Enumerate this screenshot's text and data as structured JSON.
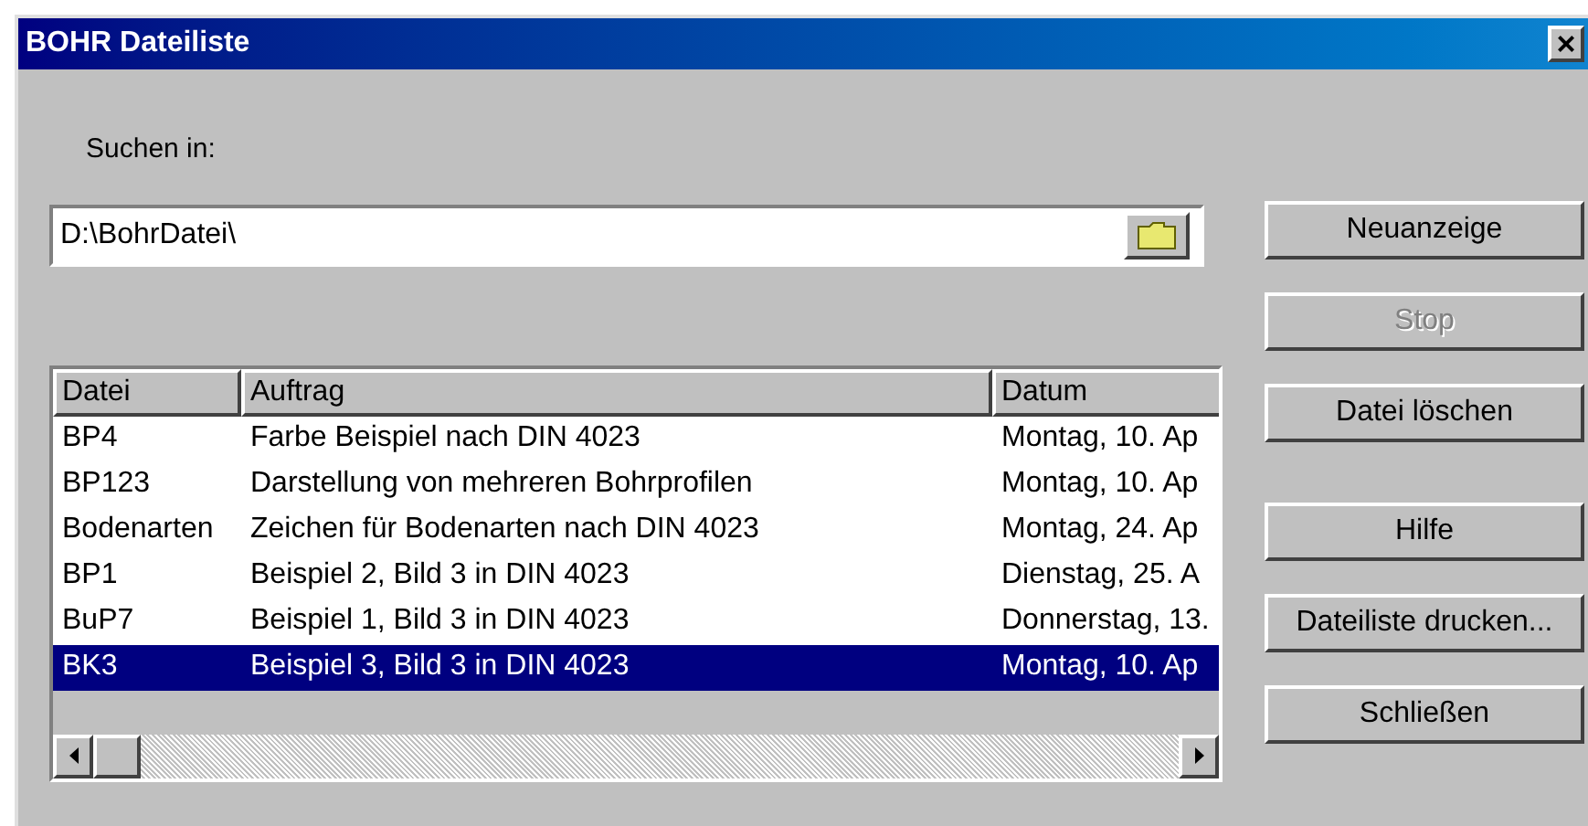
{
  "window": {
    "title": "BOHR Dateiliste",
    "close": "×"
  },
  "search_in": {
    "label": "Suchen in:",
    "value": "D:\\BohrDatei\\"
  },
  "table": {
    "columns": [
      "Datei",
      "Auftrag",
      "Datum"
    ],
    "rows": [
      {
        "cells": [
          "BP4",
          "Farbe Beispiel nach DIN 4023",
          "Montag, 10. Ap"
        ],
        "selected": false
      },
      {
        "cells": [
          "BP123",
          "Darstellung von mehreren Bohrprofilen",
          "Montag, 10. Ap"
        ],
        "selected": false
      },
      {
        "cells": [
          "Bodenarten",
          "Zeichen für Bodenarten nach DIN 4023",
          "Montag, 24. Ap"
        ],
        "selected": false
      },
      {
        "cells": [
          "BP1",
          "Beispiel 2, Bild 3 in DIN 4023",
          "Dienstag, 25. A"
        ],
        "selected": false
      },
      {
        "cells": [
          "BuP7",
          "Beispiel 1, Bild 3 in DIN 4023",
          "Donnerstag, 13."
        ],
        "selected": false
      },
      {
        "cells": [
          "BK3",
          "Beispiel 3, Bild 3 in DIN 4023",
          "Montag, 10. Ap"
        ],
        "selected": true
      }
    ]
  },
  "buttons": [
    {
      "label": "Neuanzeige",
      "disabled": false
    },
    {
      "label": "Stop",
      "disabled": true
    },
    {
      "label": "Datei löschen",
      "disabled": false
    },
    {
      "label": "Hilfe",
      "disabled": false
    },
    {
      "label": "Dateiliste drucken...",
      "disabled": false
    },
    {
      "label": "Schließen",
      "disabled": false
    }
  ]
}
